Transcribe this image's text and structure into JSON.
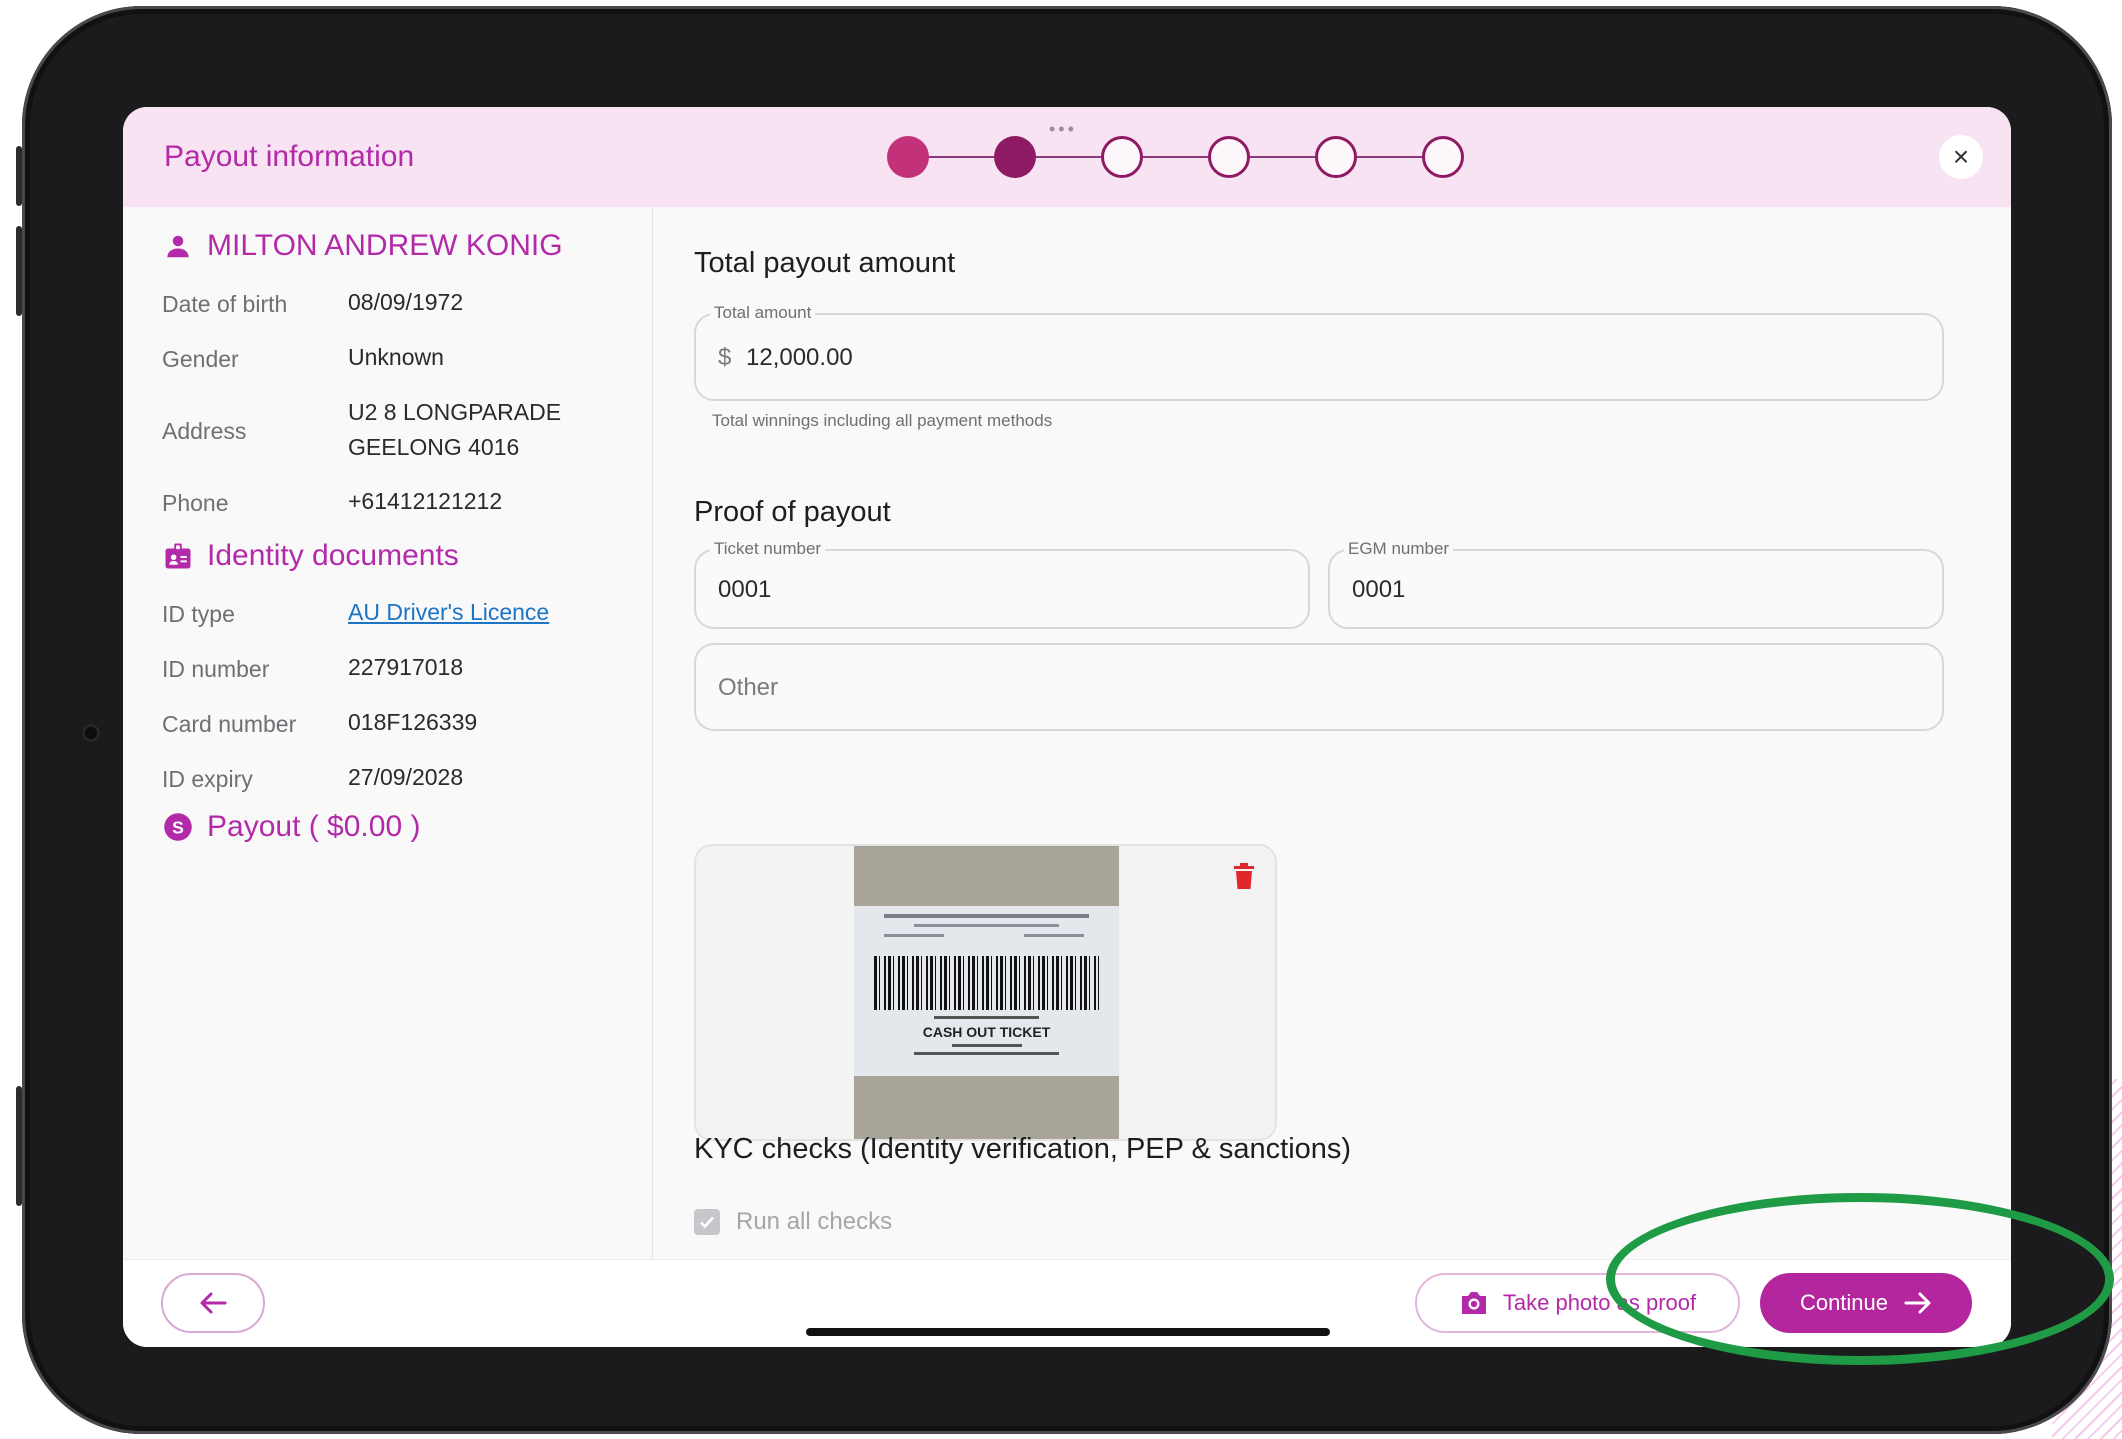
{
  "modal": {
    "title": "Payout information",
    "grabber": "•••",
    "close_icon": "×"
  },
  "stepper": {
    "steps": [
      "done",
      "current",
      "todo",
      "todo",
      "todo",
      "todo"
    ],
    "colors": {
      "done": "#c2317a",
      "current": "#8e1a63"
    }
  },
  "customer": {
    "name": "MILTON ANDREW KONIG",
    "dob_label": "Date of birth",
    "dob": "08/09/1972",
    "gender_label": "Gender",
    "gender": "Unknown",
    "address_label": "Address",
    "address_line1": "U2 8 LONGPARADE",
    "address_line2": "GEELONG 4016",
    "phone_label": "Phone",
    "phone": "+61412121212"
  },
  "identity": {
    "title": "Identity documents",
    "id_type_label": "ID type",
    "id_type": "AU Driver's Licence",
    "id_number_label": "ID number",
    "id_number": "227917018",
    "card_number_label": "Card number",
    "card_number": "018F126339",
    "expiry_label": "ID expiry",
    "expiry": "27/09/2028"
  },
  "payout_summary": {
    "label": "Payout ( $0.00 )"
  },
  "total": {
    "heading": "Total payout amount",
    "field_label": "Total amount",
    "currency": "$",
    "value": "12,000.00",
    "helper": "Total winnings including all payment methods"
  },
  "proof": {
    "heading": "Proof of payout",
    "ticket_label": "Ticket number",
    "ticket_value": "0001",
    "egm_label": "EGM number",
    "egm_value": "0001",
    "other_placeholder": "Other",
    "ticket_caption": "CASH OUT TICKET"
  },
  "kyc": {
    "heading": "KYC checks (Identity verification, PEP & sanctions)",
    "run_all_label": "Run all checks",
    "run_all_checked": true
  },
  "footer": {
    "take_photo_label": "Take photo as proof",
    "continue_label": "Continue"
  },
  "colors": {
    "accent": "#b32aa8",
    "primary_button": "#b3269e",
    "header_bg": "#f8e3f3",
    "annotation": "#1f9b45"
  },
  "icons": [
    "person-icon",
    "id-badge-icon",
    "dollar-circle-icon",
    "close-icon",
    "trash-icon",
    "camera-icon",
    "arrow-right-icon",
    "arrow-left-icon",
    "check-icon"
  ]
}
